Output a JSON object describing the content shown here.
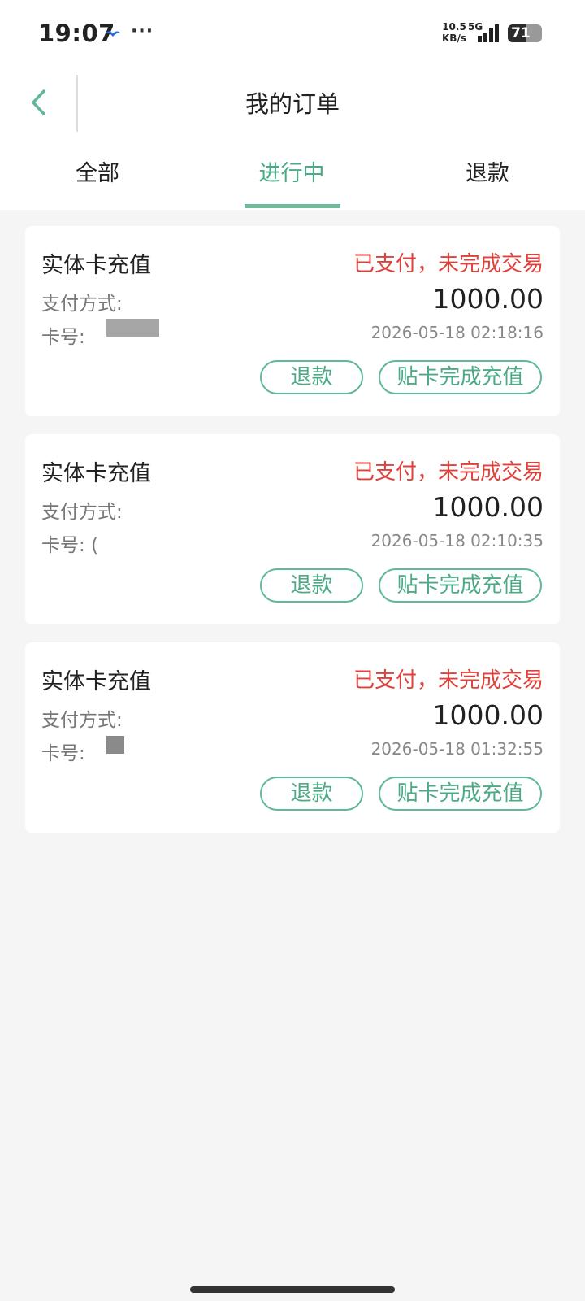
{
  "status_bar": {
    "time": "19:07",
    "dots": "···",
    "speed_value": "10.5",
    "speed_unit": "KB/s",
    "network": "5G",
    "battery": "71",
    "battery_level_percent": 71
  },
  "nav": {
    "title": "我的订单"
  },
  "tabs": [
    {
      "label": "全部"
    },
    {
      "label": "进行中"
    },
    {
      "label": "退款"
    }
  ],
  "orders": [
    {
      "title": "实体卡充值",
      "status": "已支付，未完成交易",
      "pay_label": "支付方式:",
      "amount": "1000.00",
      "card_label": "卡号:",
      "time": "2026-05-18 02:18:16",
      "refund_button": "退款",
      "complete_button": "贴卡完成充值"
    },
    {
      "title": "实体卡充值",
      "status": "已支付，未完成交易",
      "pay_label": "支付方式:",
      "amount": "1000.00",
      "card_label": "卡号: (",
      "time": "2026-05-18 02:10:35",
      "refund_button": "退款",
      "complete_button": "贴卡完成充值"
    },
    {
      "title": "实体卡充值",
      "status": "已支付，未完成交易",
      "pay_label": "支付方式:",
      "amount": "1000.00",
      "card_label": "卡号:",
      "time": "2026-05-18 01:32:55",
      "refund_button": "退款",
      "complete_button": "贴卡完成充值"
    }
  ],
  "colors": {
    "accent": "#4bab85",
    "status_red": "#e0413a",
    "background": "#f5f5f5"
  },
  "icons": {
    "back": "chevron-left-icon",
    "bird": "bird-icon",
    "signal": "signal-icon",
    "battery": "battery-icon"
  }
}
